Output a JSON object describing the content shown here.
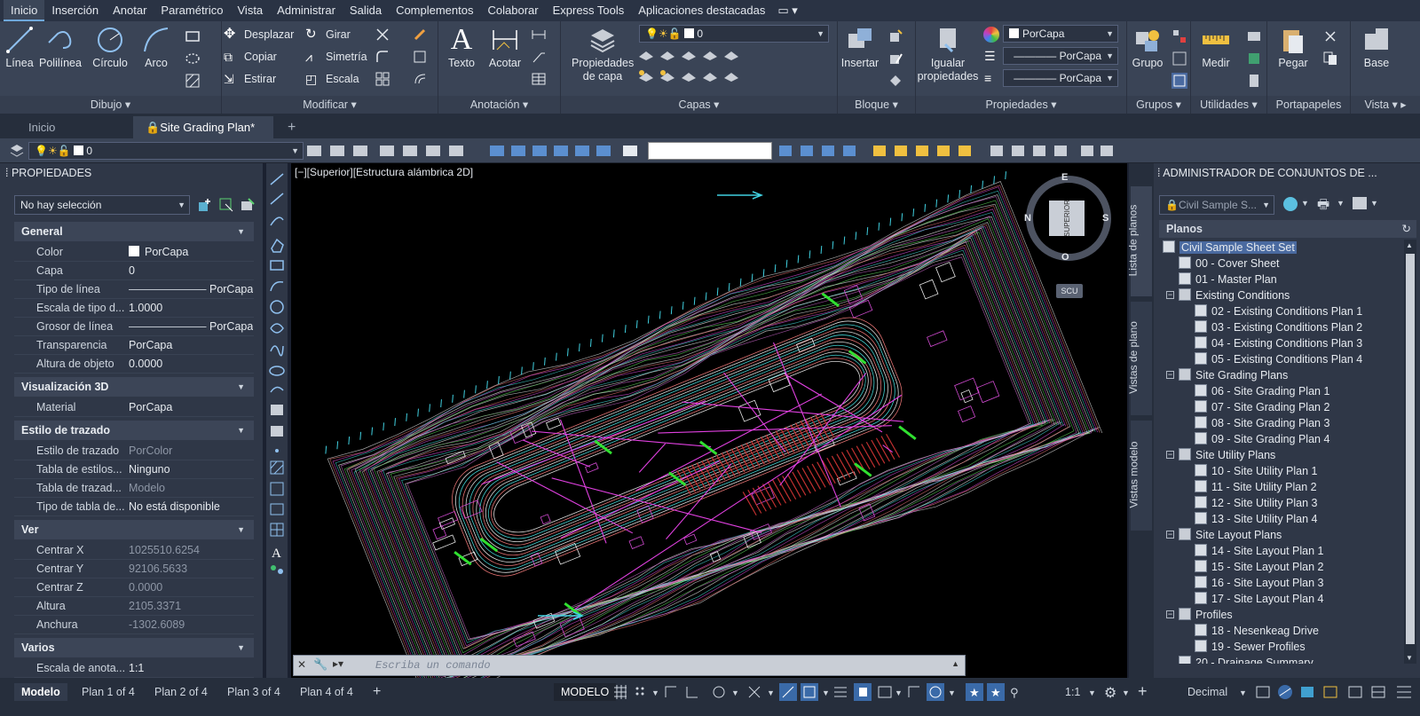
{
  "menubar": {
    "items": [
      "Inicio",
      "Inserción",
      "Anotar",
      "Paramétrico",
      "Vista",
      "Administrar",
      "Salida",
      "Complementos",
      "Colaborar",
      "Express Tools",
      "Aplicaciones destacadas"
    ]
  },
  "ribbon": {
    "dibujo": {
      "title": "Dibujo",
      "linea": "Línea",
      "polilinea": "Polilínea",
      "circulo": "Círculo",
      "arco": "Arco"
    },
    "modificar": {
      "title": "Modificar",
      "desplazar": "Desplazar",
      "girar": "Girar",
      "copiar": "Copiar",
      "simetria": "Simetría",
      "estirar": "Estirar",
      "escala": "Escala"
    },
    "anotacion": {
      "title": "Anotación",
      "texto": "Texto",
      "acotar": "Acotar"
    },
    "capas": {
      "title": "Capas",
      "propiedades": "Propiedades",
      "de_capa": "de capa",
      "layer_value": "0"
    },
    "bloque": {
      "title": "Bloque",
      "insertar": "Insertar"
    },
    "propiedades": {
      "title": "Propiedades",
      "igualar": "Igualar",
      "propiedades": "propiedades",
      "color": "PorCapa",
      "linetype": "PorCapa",
      "lineweight": "PorCapa"
    },
    "grupos": {
      "title": "Grupos",
      "grupo": "Grupo"
    },
    "utilidades": {
      "title": "Utilidades",
      "medir": "Medir"
    },
    "portapapeles": {
      "title": "Portapapeles",
      "pegar": "Pegar"
    },
    "vista": {
      "title": "Vista",
      "base": "Base"
    }
  },
  "doctabs": {
    "inicio": "Inicio",
    "active": "Site Grading Plan*"
  },
  "toolbar2": {
    "layer_value": "0"
  },
  "props": {
    "title": "PROPIEDADES",
    "selection": "No hay selección",
    "general": {
      "head": "General",
      "rows": [
        [
          "Color",
          "PorCapa"
        ],
        [
          "Capa",
          "0"
        ],
        [
          "Tipo de línea",
          "PorCapa"
        ],
        [
          "Escala de tipo d...",
          "1.0000"
        ],
        [
          "Grosor de línea",
          "PorCapa"
        ],
        [
          "Transparencia",
          "PorCapa"
        ],
        [
          "Altura de objeto",
          "0.0000"
        ]
      ]
    },
    "vis3d": {
      "head": "Visualización 3D",
      "rows": [
        [
          "Material",
          "PorCapa"
        ]
      ]
    },
    "trazado": {
      "head": "Estilo de trazado",
      "rows": [
        [
          "Estilo de trazado",
          "PorColor"
        ],
        [
          "Tabla de estilos...",
          "Ninguno"
        ],
        [
          "Tabla de trazad...",
          "Modelo"
        ],
        [
          "Tipo de tabla de...",
          "No está disponible"
        ]
      ]
    },
    "ver": {
      "head": "Ver",
      "rows": [
        [
          "Centrar X",
          "1025510.6254"
        ],
        [
          "Centrar Y",
          "92106.5633"
        ],
        [
          "Centrar Z",
          "0.0000"
        ],
        [
          "Altura",
          "2105.3371"
        ],
        [
          "Anchura",
          "-1302.6089"
        ]
      ]
    },
    "varios": {
      "head": "Varios",
      "rows": [
        [
          "Escala de anota...",
          "1:1"
        ]
      ]
    }
  },
  "canvas": {
    "viewport_label": "[−][Superior][Estructura alámbrica 2D]",
    "viewcube": "SUPERIOR",
    "compass_e": "E",
    "compass_s": "S",
    "compass_n": "N",
    "compass_o": "O",
    "wcs": "SCU",
    "command_placeholder": "Escriba un comando"
  },
  "vtabs": {
    "lista": "Lista de planos",
    "vistas": "Vistas de plano",
    "modelo": "Vistas modelo"
  },
  "ssm": {
    "title": "ADMINISTRADOR DE CONJUNTOS DE ...",
    "combo": "Civil Sample S...",
    "planos": "Planos",
    "tree": [
      {
        "t": "Civil Sample Sheet Set",
        "lvl": 0,
        "sel": true
      },
      {
        "t": "00 - Cover Sheet",
        "lvl": 1
      },
      {
        "t": "01 - Master Plan",
        "lvl": 1
      },
      {
        "t": "Existing Conditions",
        "lvl": 1,
        "grp": true
      },
      {
        "t": "02 - Existing Conditions Plan 1",
        "lvl": 2
      },
      {
        "t": "03 - Existing Conditions Plan 2",
        "lvl": 2
      },
      {
        "t": "04 - Existing Conditions Plan 3",
        "lvl": 2
      },
      {
        "t": "05 - Existing Conditions Plan 4",
        "lvl": 2
      },
      {
        "t": "Site Grading Plans",
        "lvl": 1,
        "grp": true
      },
      {
        "t": "06 - Site Grading Plan 1",
        "lvl": 2
      },
      {
        "t": "07 - Site Grading Plan 2",
        "lvl": 2
      },
      {
        "t": "08 - Site Grading Plan 3",
        "lvl": 2
      },
      {
        "t": "09 - Site Grading Plan 4",
        "lvl": 2
      },
      {
        "t": "Site Utility Plans",
        "lvl": 1,
        "grp": true
      },
      {
        "t": "10 - Site Utility Plan 1",
        "lvl": 2
      },
      {
        "t": "11 - Site Utility Plan 2",
        "lvl": 2
      },
      {
        "t": "12 - Site Utility Plan 3",
        "lvl": 2
      },
      {
        "t": "13 - Site Utility Plan 4",
        "lvl": 2
      },
      {
        "t": "Site Layout Plans",
        "lvl": 1,
        "grp": true
      },
      {
        "t": "14 - Site Layout Plan 1",
        "lvl": 2
      },
      {
        "t": "15 - Site Layout Plan 2",
        "lvl": 2
      },
      {
        "t": "16 - Site Layout Plan 3",
        "lvl": 2
      },
      {
        "t": "17 - Site Layout Plan 4",
        "lvl": 2
      },
      {
        "t": "Profiles",
        "lvl": 1,
        "grp": true
      },
      {
        "t": "18 - Nesenkeag Drive",
        "lvl": 2
      },
      {
        "t": "19 - Sewer Profiles",
        "lvl": 2
      },
      {
        "t": "20 - Drainage Summary",
        "lvl": 1
      }
    ]
  },
  "status": {
    "layouts": [
      "Modelo",
      "Plan 1 of 4",
      "Plan 2 of 4",
      "Plan 3 of 4",
      "Plan 4 of 4"
    ],
    "modelo": "MODELO",
    "scale": "1:1",
    "units": "Decimal"
  },
  "colors": {
    "accent": "#6fa8dc",
    "ribbon": "#3a4456",
    "panel": "#2f3747",
    "canvas": "#000000"
  }
}
